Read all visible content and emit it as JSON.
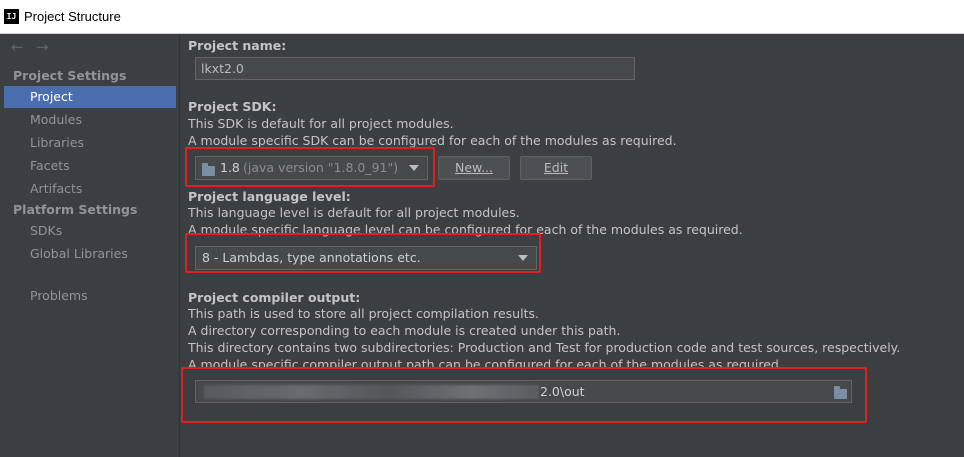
{
  "window": {
    "title": "Project Structure",
    "app_icon": "IJ"
  },
  "sidebar": {
    "back_icon": "←",
    "forward_icon": "→",
    "project_settings_heading": "Project Settings",
    "project_settings_items": [
      "Project",
      "Modules",
      "Libraries",
      "Facets",
      "Artifacts"
    ],
    "platform_settings_heading": "Platform Settings",
    "platform_settings_items": [
      "SDKs",
      "Global Libraries"
    ],
    "problems_item": "Problems",
    "selected": "Project"
  },
  "project_name": {
    "label": "Project name:",
    "value": "lkxt2.0"
  },
  "project_sdk": {
    "label": "Project SDK:",
    "line1": "This SDK is default for all project modules.",
    "line2": "A module specific SDK can be configured for each of the modules as required.",
    "selected_value": "1.8",
    "selected_detail": "(java version \"1.8.0_91\")",
    "new_button": "New...",
    "edit_button": "Edit"
  },
  "language_level": {
    "label": "Project language level:",
    "line1": "This language level is default for all project modules.",
    "line2": "A module specific language level can be configured for each of the modules as required.",
    "selected_value": "8 - Lambdas, type annotations etc."
  },
  "compiler_output": {
    "label": "Project compiler output:",
    "line1": "This path is used to store all project compilation results.",
    "line2": "A directory corresponding to each module is created under this path.",
    "line3": "This directory contains two subdirectories: Production and Test for production code and test sources, respectively.",
    "line4": "A module specific compiler output path can be configured for each of the modules as required.",
    "path_visible_suffix": "2.0\\out",
    "browse_icon": "folder-icon"
  },
  "colors": {
    "highlight_box": "#e02020",
    "selection": "#4b6eaf",
    "background": "#3c3f41"
  }
}
